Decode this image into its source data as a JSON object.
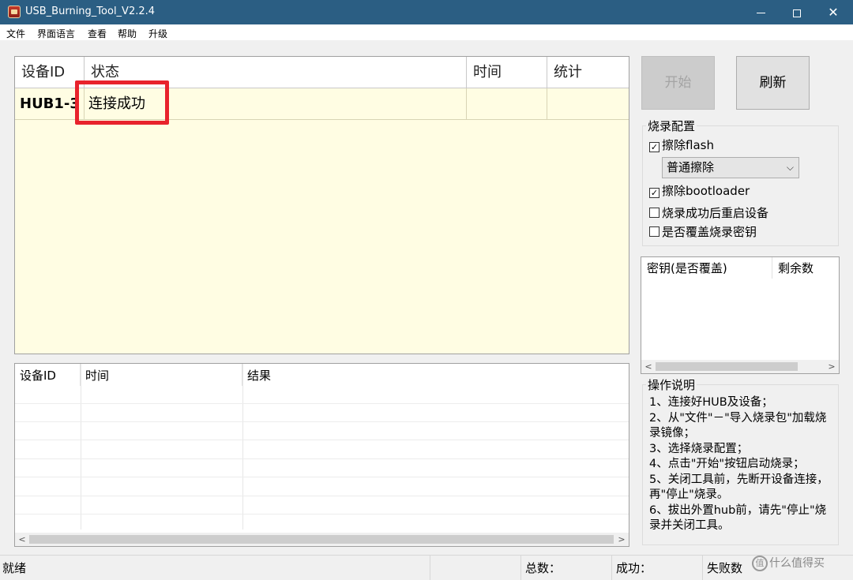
{
  "window": {
    "title": "USB_Burning_Tool_V2.2.4"
  },
  "menu": [
    "文件",
    "界面语言",
    "查看",
    "帮助",
    "升级"
  ],
  "device_grid": {
    "columns": [
      "设备ID",
      "状态",
      "时间",
      "统计"
    ],
    "rows": [
      {
        "id": "HUB1-3",
        "status": "连接成功",
        "time": "",
        "stats": ""
      }
    ]
  },
  "log_grid": {
    "columns": [
      "设备ID",
      "时间",
      "结果"
    ]
  },
  "buttons": {
    "start": "开始",
    "refresh": "刷新"
  },
  "burn_config": {
    "title": "烧录配置",
    "erase_flash": {
      "label": "擦除flash",
      "checked": true
    },
    "erase_mode": "普通擦除",
    "erase_bootloader": {
      "label": "擦除bootloader",
      "checked": true
    },
    "reboot_after": {
      "label": "烧录成功后重启设备",
      "checked": false
    },
    "overwrite_key": {
      "label": "是否覆盖烧录密钥",
      "checked": false
    }
  },
  "key_list": {
    "columns": [
      "密钥(是否覆盖)",
      "剩余数"
    ]
  },
  "instructions": {
    "title": "操作说明",
    "text": "1、连接好HUB及设备；\n2、从\"文件\"－\"导入烧录包\"加载烧录镜像；\n3、选择烧录配置；\n4、点击\"开始\"按钮启动烧录；\n5、关闭工具前，先断开设备连接，再\"停止\"烧录。\n6、拔出外置hub前，请先\"停止\"烧录并关闭工具。"
  },
  "status_bar": {
    "state": "就绪",
    "total": "总数：",
    "success": "成功：",
    "fail": "失败数"
  },
  "watermark": "什么值得买",
  "colors": {
    "titlebar": "#2b5e83",
    "grid_bg": "#fffde3",
    "highlight": "#e8232c"
  }
}
